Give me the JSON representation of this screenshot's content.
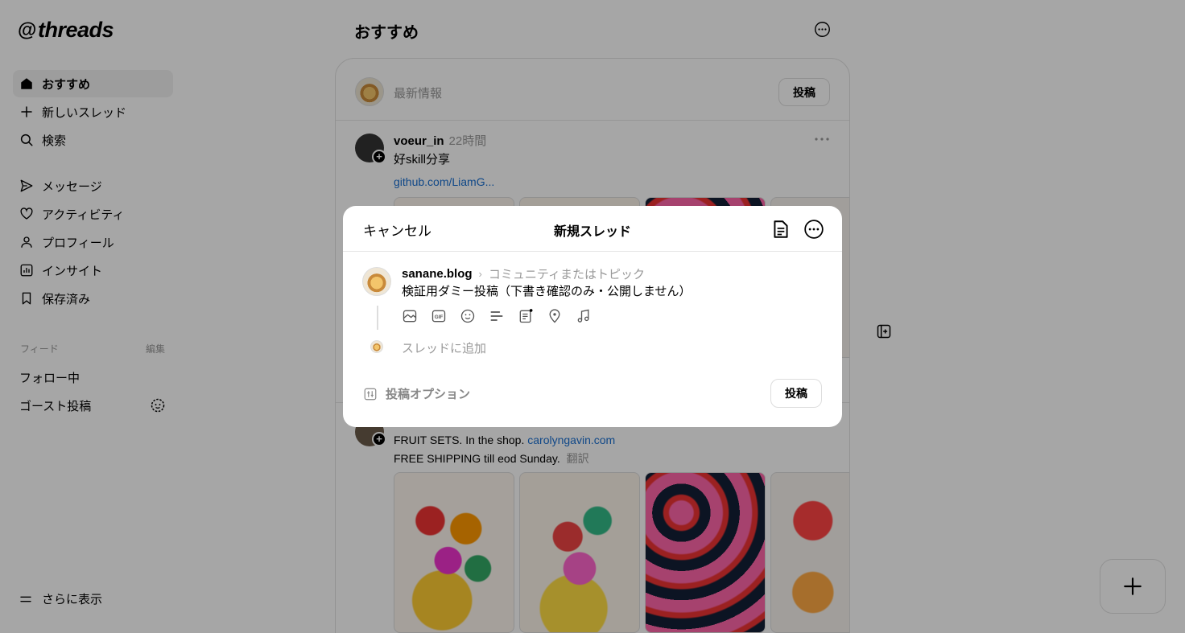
{
  "app": {
    "logo_text": "threads"
  },
  "sidebar": {
    "nav": [
      {
        "label": "おすすめ",
        "icon": "home-icon",
        "active": true
      },
      {
        "label": "新しいスレッド",
        "icon": "plus-icon"
      },
      {
        "label": "検索",
        "icon": "search-icon"
      },
      {
        "label": "メッセージ",
        "icon": "send-icon"
      },
      {
        "label": "アクティビティ",
        "icon": "heart-icon"
      },
      {
        "label": "プロフィール",
        "icon": "user-icon"
      },
      {
        "label": "インサイト",
        "icon": "insights-icon"
      },
      {
        "label": "保存済み",
        "icon": "bookmark-icon"
      }
    ],
    "feeds_label": "フィード",
    "edit_label": "編集",
    "feeds": [
      {
        "label": "フォロー中"
      },
      {
        "label": "ゴースト投稿"
      }
    ],
    "more_label": "さらに表示"
  },
  "feed": {
    "title": "おすすめ",
    "composer": {
      "placeholder": "最新情報",
      "post_label": "投稿"
    },
    "posts": [
      {
        "username": "voeur_in",
        "time": "22時間",
        "text": "好skill分享",
        "link": "github.com/LiamG..."
      },
      {
        "text1": "FRUIT SETS. In the shop.",
        "link": "carolyngavin.com",
        "text2": "FREE SHIPPING till eod Sunday.",
        "translate": "翻訳"
      }
    ]
  },
  "modal": {
    "cancel": "キャンセル",
    "title": "新規スレッド",
    "username": "sanane.blog",
    "topic_placeholder": "コミュニティまたはトピック",
    "text": "検証用ダミー投稿（下書き確認のみ・公開しません）",
    "add_thread": "スレッドに追加",
    "options": "投稿オプション",
    "post_label": "投稿"
  }
}
